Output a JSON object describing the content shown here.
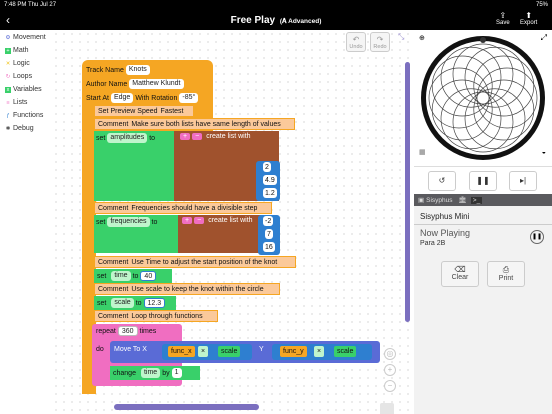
{
  "status_bar": {
    "time": "7:48 PM",
    "date": "Thu Jul 27",
    "battery": "75%"
  },
  "header": {
    "back_icon": "chevron-left",
    "title": "Free Play",
    "mode": "(𝐀 Advanced)",
    "save": "Save",
    "export": "Export"
  },
  "toolbar": {
    "undo": "Undo",
    "redo": "Redo"
  },
  "categories": [
    {
      "label": "Movement",
      "color": "#5a6bd6"
    },
    {
      "label": "Math",
      "color": "#39d06a"
    },
    {
      "label": "Logic",
      "color": "#f0c419"
    },
    {
      "label": "Loops",
      "color": "#f06ec1"
    },
    {
      "label": "Variables",
      "color": "#39d06a"
    },
    {
      "label": "Lists",
      "color": "#f06ec1"
    },
    {
      "label": "Functions",
      "color": "#2e7fd0"
    },
    {
      "label": "Debug",
      "color": "#555"
    }
  ],
  "program": {
    "track_name_label": "Track Name",
    "track_name": "Knots",
    "author_label": "Author Name",
    "author": "Matthew Klundt",
    "start_label": "Start At",
    "start_at": "Edge",
    "rotation_label": "With Rotation",
    "rotation": "-85°",
    "preview_label": "Set Preview Speed",
    "preview_speed": "Fastest",
    "comment1": "Make sure both lists have same length of values",
    "set1_var": "amplitudes",
    "to": "to",
    "create_list": "create list with",
    "amp_values": [
      "2",
      "4.9",
      "1.2"
    ],
    "comment2": "Frequencies should have a divisible step",
    "set2_var": "frequencies",
    "freq_values": [
      "-2",
      "7",
      "16"
    ],
    "comment3": "Use Time to adjust the start position of the knot",
    "time_var": "time",
    "time_val": "40",
    "comment4": "Use scale to keep the knot within the circle",
    "scale_var": "scale",
    "scale_val": "12.3",
    "comment5": "Loop through functions",
    "repeat": "repeat",
    "repeat_count": "360",
    "times": "times",
    "do": "do",
    "move": "Move To X",
    "func_x": "func_x",
    "y": "Y",
    "func_y": "func_y",
    "op": "×",
    "change": "change",
    "by": "by",
    "change_val": "1",
    "comment_label": "Comment",
    "set_label": "set"
  },
  "device": {
    "tab1": "Sisyphus",
    "name": "Sisyphus Mini",
    "now_playing": "Now Playing",
    "track": "Para 2B",
    "clear": "Clear",
    "print": "Print"
  }
}
